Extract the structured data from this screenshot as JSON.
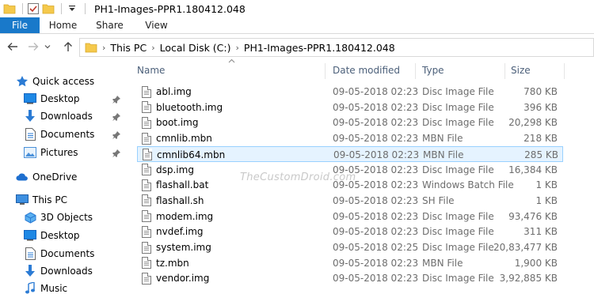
{
  "window": {
    "title": "PH1-Images-PPR1.180412.048"
  },
  "ribbon": {
    "tabs": [
      "File",
      "Home",
      "Share",
      "View"
    ]
  },
  "address": {
    "crumbs": [
      "This PC",
      "Local Disk (C:)",
      "PH1-Images-PPR1.180412.048"
    ]
  },
  "navpane": {
    "quick_access_label": "Quick access",
    "quick_access": [
      "Desktop",
      "Downloads",
      "Documents",
      "Pictures"
    ],
    "onedrive_label": "OneDrive",
    "thispc_label": "This PC",
    "thispc_items": [
      "3D Objects",
      "Desktop",
      "Documents",
      "Downloads",
      "Music"
    ]
  },
  "columns": {
    "name": "Name",
    "date": "Date modified",
    "type": "Type",
    "size": "Size"
  },
  "files": [
    {
      "name": "abl.img",
      "date": "09-05-2018 02:23",
      "type": "Disc Image File",
      "size": "780 KB"
    },
    {
      "name": "bluetooth.img",
      "date": "09-05-2018 02:23",
      "type": "Disc Image File",
      "size": "396 KB"
    },
    {
      "name": "boot.img",
      "date": "09-05-2018 02:23",
      "type": "Disc Image File",
      "size": "20,298 KB"
    },
    {
      "name": "cmnlib.mbn",
      "date": "09-05-2018 02:23",
      "type": "MBN File",
      "size": "218 KB"
    },
    {
      "name": "cmnlib64.mbn",
      "date": "09-05-2018 02:23",
      "type": "MBN File",
      "size": "285 KB"
    },
    {
      "name": "dsp.img",
      "date": "09-05-2018 02:23",
      "type": "Disc Image File",
      "size": "16,384 KB"
    },
    {
      "name": "flashall.bat",
      "date": "09-05-2018 02:23",
      "type": "Windows Batch File",
      "size": "1 KB"
    },
    {
      "name": "flashall.sh",
      "date": "09-05-2018 02:23",
      "type": "SH File",
      "size": "1 KB"
    },
    {
      "name": "modem.img",
      "date": "09-05-2018 02:23",
      "type": "Disc Image File",
      "size": "93,476 KB"
    },
    {
      "name": "nvdef.img",
      "date": "09-05-2018 02:23",
      "type": "Disc Image File",
      "size": "311 KB"
    },
    {
      "name": "system.img",
      "date": "09-05-2018 02:25",
      "type": "Disc Image File",
      "size": "20,83,477 KB"
    },
    {
      "name": "tz.mbn",
      "date": "09-05-2018 02:23",
      "type": "MBN File",
      "size": "1,900 KB"
    },
    {
      "name": "vendor.img",
      "date": "09-05-2018 02:23",
      "type": "Disc Image File",
      "size": "3,92,885 KB"
    }
  ],
  "selected_index": 4,
  "watermark": "TheCustomDroid.com",
  "colors": {
    "file_tab": "#1979ca",
    "selection_bg": "#e5f3ff",
    "selection_border": "#99d1ff",
    "folder": "#f5c94c",
    "header_text": "#4c607a"
  }
}
